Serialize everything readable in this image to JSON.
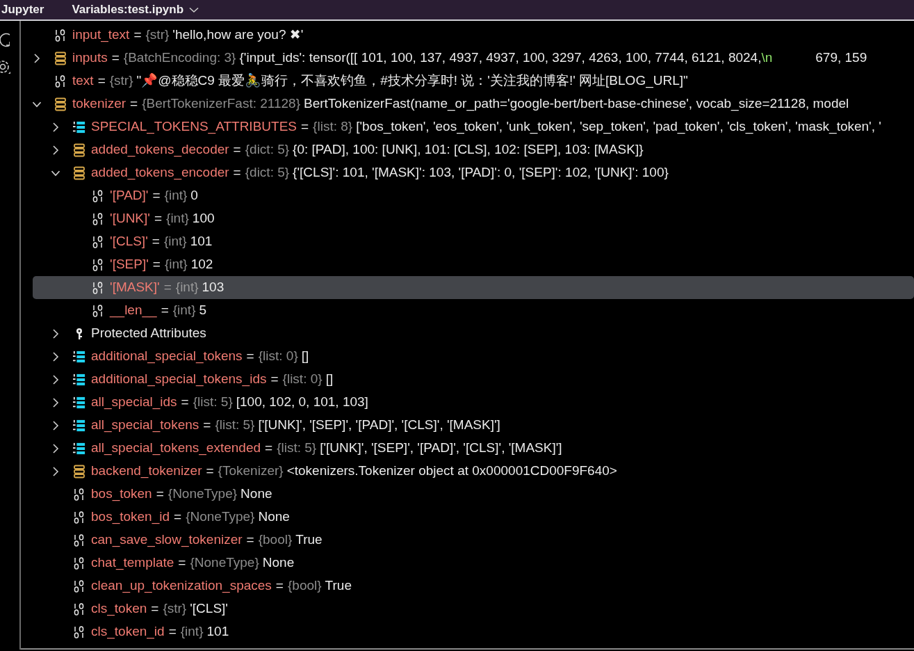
{
  "header": {
    "app": "Jupyter",
    "tab": "Variables:test.ipynb"
  },
  "tree": [
    {
      "kind": "scalar",
      "name": "input_text",
      "sep": "=",
      "type": "{str}",
      "value": "'hello,how are you? ✖'",
      "selected": false
    },
    {
      "kind": "object",
      "name": "inputs",
      "sep": "=",
      "type": "{BatchEncoding: 3}",
      "value": "{'input_ids': tensor([[ 101,  100,  137, 4937, 4937,  100, 3297, 4263,  100, 7744, 6121, 8024,",
      "escape": "\\n",
      "value_more": "679, 159",
      "expanded": false,
      "selected": false
    },
    {
      "kind": "scalar",
      "name": "text",
      "sep": "=",
      "type": "{str}",
      "value": "\"📌@稳稳C9  最爱🚴骑行，不喜欢钓鱼，#技术分享时! 说：'关注我的博客!' 网址[BLOG_URL]\"",
      "selected": false
    },
    {
      "kind": "object",
      "name": "tokenizer",
      "sep": "=",
      "type": "{BertTokenizerFast: 21128}",
      "value": "BertTokenizerFast(name_or_path='google-bert/bert-base-chinese', vocab_size=21128, model",
      "expanded": true,
      "selected": false,
      "children": [
        {
          "kind": "list",
          "name": "SPECIAL_TOKENS_ATTRIBUTES",
          "sep": "=",
          "type": "{list: 8}",
          "value": "['bos_token', 'eos_token', 'unk_token', 'sep_token', 'pad_token', 'cls_token', 'mask_token', '",
          "expanded": false,
          "selected": false
        },
        {
          "kind": "object",
          "name": "added_tokens_decoder",
          "sep": "=",
          "type": "{dict: 5}",
          "value": "{0: [PAD], 100: [UNK], 101: [CLS], 102: [SEP], 103: [MASK]}",
          "expanded": false,
          "selected": false
        },
        {
          "kind": "object",
          "name": "added_tokens_encoder",
          "sep": "=",
          "type": "{dict: 5}",
          "value": "{'[CLS]': 101, '[MASK]': 103, '[PAD]': 0, '[SEP]': 102, '[UNK]': 100}",
          "expanded": true,
          "selected": false,
          "children": [
            {
              "kind": "scalar",
              "name": "'[PAD]'",
              "sep": "=",
              "type": "{int}",
              "value": "0",
              "selected": false
            },
            {
              "kind": "scalar",
              "name": "'[UNK]'",
              "sep": "=",
              "type": "{int}",
              "value": "100",
              "selected": false
            },
            {
              "kind": "scalar",
              "name": "'[CLS]'",
              "sep": "=",
              "type": "{int}",
              "value": "101",
              "selected": false
            },
            {
              "kind": "scalar",
              "name": "'[SEP]'",
              "sep": "=",
              "type": "{int}",
              "value": "102",
              "selected": false
            },
            {
              "kind": "scalar",
              "name": "'[MASK]'",
              "sep": "=",
              "type": "{int}",
              "value": "103",
              "selected": true
            },
            {
              "kind": "scalar",
              "name": "__len__",
              "sep": "=",
              "type": "{int}",
              "value": "5",
              "selected": false
            }
          ]
        },
        {
          "kind": "protected",
          "name": "Protected Attributes",
          "expanded": false,
          "selected": false
        },
        {
          "kind": "list",
          "name": "additional_special_tokens",
          "sep": "=",
          "type": "{list: 0}",
          "value": "[]",
          "expanded": false,
          "selected": false
        },
        {
          "kind": "list",
          "name": "additional_special_tokens_ids",
          "sep": "=",
          "type": "{list: 0}",
          "value": "[]",
          "expanded": false,
          "selected": false
        },
        {
          "kind": "list",
          "name": "all_special_ids",
          "sep": "=",
          "type": "{list: 5}",
          "value": "[100, 102, 0, 101, 103]",
          "expanded": false,
          "selected": false
        },
        {
          "kind": "list",
          "name": "all_special_tokens",
          "sep": "=",
          "type": "{list: 5}",
          "value": "['[UNK]', '[SEP]', '[PAD]', '[CLS]', '[MASK]']",
          "expanded": false,
          "selected": false
        },
        {
          "kind": "list",
          "name": "all_special_tokens_extended",
          "sep": "=",
          "type": "{list: 5}",
          "value": "['[UNK]', '[SEP]', '[PAD]', '[CLS]', '[MASK]']",
          "expanded": false,
          "selected": false
        },
        {
          "kind": "object",
          "name": "backend_tokenizer",
          "sep": "=",
          "type": "{Tokenizer}",
          "value": "<tokenizers.Tokenizer object at 0x000001CD00F9F640>",
          "expanded": false,
          "selected": false
        },
        {
          "kind": "scalar",
          "name": "bos_token",
          "sep": "=",
          "type": "{NoneType}",
          "value": "None",
          "selected": false
        },
        {
          "kind": "scalar",
          "name": "bos_token_id",
          "sep": "=",
          "type": "{NoneType}",
          "value": "None",
          "selected": false
        },
        {
          "kind": "scalar",
          "name": "can_save_slow_tokenizer",
          "sep": "=",
          "type": "{bool}",
          "value": "True",
          "selected": false
        },
        {
          "kind": "scalar",
          "name": "chat_template",
          "sep": "=",
          "type": "{NoneType}",
          "value": "None",
          "selected": false
        },
        {
          "kind": "scalar",
          "name": "clean_up_tokenization_spaces",
          "sep": "=",
          "type": "{bool}",
          "value": "True",
          "selected": false
        },
        {
          "kind": "scalar",
          "name": "cls_token",
          "sep": "=",
          "type": "{str}",
          "value": "'[CLS]'",
          "selected": false
        },
        {
          "kind": "scalar",
          "name": "cls_token_id",
          "sep": "=",
          "type": "{int}",
          "value": "101",
          "selected": false
        }
      ]
    }
  ]
}
